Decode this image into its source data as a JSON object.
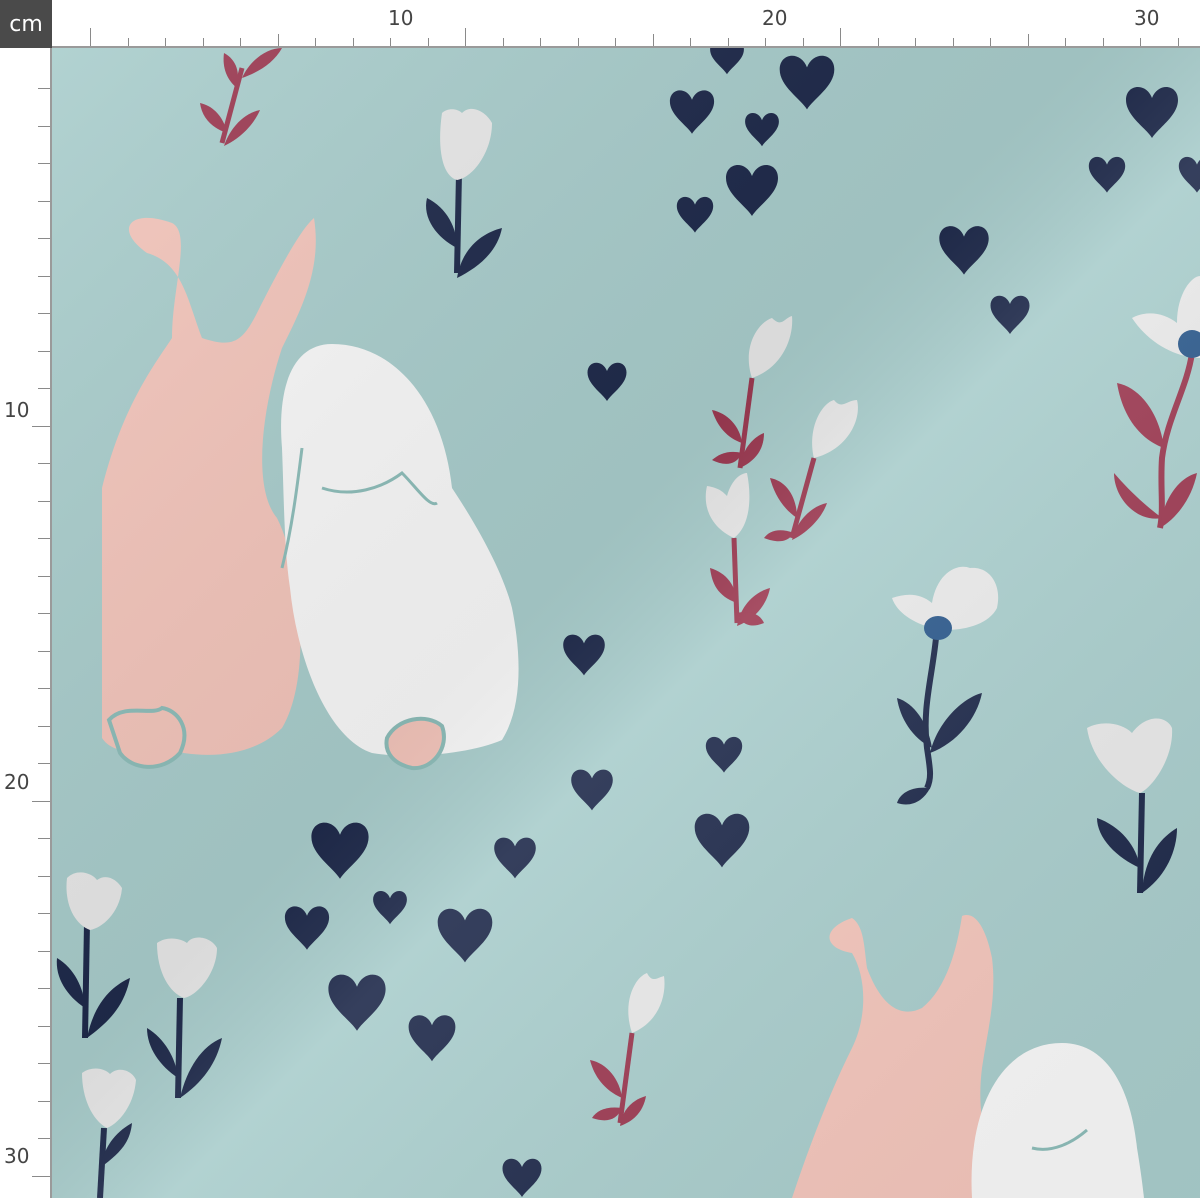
{
  "ruler": {
    "unit": "cm",
    "labels": [
      "10",
      "20",
      "30"
    ]
  },
  "fabric": {
    "background_color": "#a9cdcc",
    "motifs": [
      "pink-bunny",
      "white-bunny",
      "navy-hearts",
      "white-tulips",
      "maroon-sprigs",
      "white-poppy-blue-center"
    ],
    "colors": {
      "pink_bunny": "#f3c5bb",
      "white_bunny": "#f8f8f8",
      "hearts": "#1f2a4b",
      "sprig": "#9c3a52",
      "flower_center": "#2d5a8c"
    }
  }
}
